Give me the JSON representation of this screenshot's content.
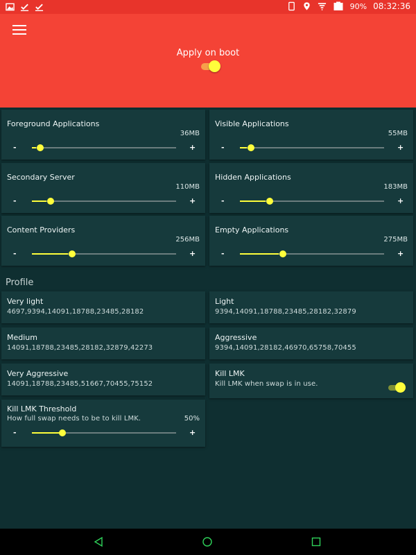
{
  "status_bar": {
    "icons_left": [
      "image-icon",
      "check-icon",
      "check-icon"
    ],
    "icons_right": [
      "phone-icon",
      "location-icon",
      "wifi-icon",
      "battery-icon"
    ],
    "battery": "90%",
    "time": "08:32:36"
  },
  "header": {
    "menu_icon": "menu-icon",
    "apply_on_boot_label": "Apply on boot",
    "apply_on_boot_enabled": true
  },
  "minfree": [
    {
      "title": "Foreground Applications",
      "value": "36MB",
      "fraction": 0.03
    },
    {
      "title": "Visible Applications",
      "value": "55MB",
      "fraction": 0.05
    },
    {
      "title": "Secondary Server",
      "value": "110MB",
      "fraction": 0.1
    },
    {
      "title": "Hidden Applications",
      "value": "183MB",
      "fraction": 0.18
    },
    {
      "title": "Content Providers",
      "value": "256MB",
      "fraction": 0.25
    },
    {
      "title": "Empty Applications",
      "value": "275MB",
      "fraction": 0.27
    }
  ],
  "slider_minus": "-",
  "slider_plus": "+",
  "profile_header": "Profile",
  "profiles": [
    {
      "title": "Very light",
      "values": "4697,9394,14091,18788,23485,28182"
    },
    {
      "title": "Light",
      "values": "9394,14091,18788,23485,28182,32879"
    },
    {
      "title": "Medium",
      "values": "14091,18788,23485,28182,32879,42273"
    },
    {
      "title": "Aggressive",
      "values": "9394,14091,28182,46970,65758,70455"
    },
    {
      "title": "Very Aggressive",
      "values": "14091,18788,23485,51667,70455,75152"
    }
  ],
  "kill_lmk": {
    "title": "Kill LMK",
    "summary": "Kill LMK when swap is in use.",
    "enabled": true
  },
  "kill_lmk_threshold": {
    "title": "Kill LMK Threshold",
    "summary": "How full swap needs to be to kill LMK.",
    "value": "50%",
    "fraction": 0.2
  },
  "colors": {
    "header": "#f44336",
    "status_bar": "#e8342b",
    "background": "#0f2f31",
    "card": "#163a3c",
    "accent": "#ffff3b",
    "nav_back": "#2fd35a"
  },
  "nav": [
    "back-icon",
    "home-icon",
    "recents-icon"
  ]
}
